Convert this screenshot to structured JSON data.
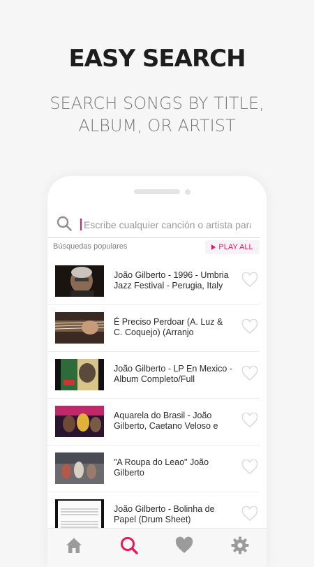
{
  "promo": {
    "headline": "EASY SEARCH",
    "subhead_line1": "SEARCH SONGS BY TITLE,",
    "subhead_line2": "ALBUM, OR ARTIST"
  },
  "search": {
    "placeholder": "Escribe cualquier canción o artista para b"
  },
  "popular_label": "Búsquedas populares",
  "play_all_label": "PLAY ALL",
  "songs": [
    {
      "title": "João Gilberto - 1996 - Umbria Jazz Festival - Perugia, Italy"
    },
    {
      "title": "É Preciso Perdoar (A. Luz & C. Coquejo) (Arranjo"
    },
    {
      "title": "João Gilberto - LP En Mexico - Album Completo/Full"
    },
    {
      "title": "Aquarela do Brasil - João Gilberto, Caetano Veloso e"
    },
    {
      "title": "\"A Roupa do Leao\" João Gilberto"
    },
    {
      "title": "João Gilberto - Bolinha de Papel (Drum Sheet)"
    }
  ],
  "tabs": [
    "home-icon",
    "search-icon",
    "heart-icon",
    "gear-icon"
  ],
  "colors": {
    "accent": "#e8195a",
    "icon_gray": "#9b9b9b"
  }
}
